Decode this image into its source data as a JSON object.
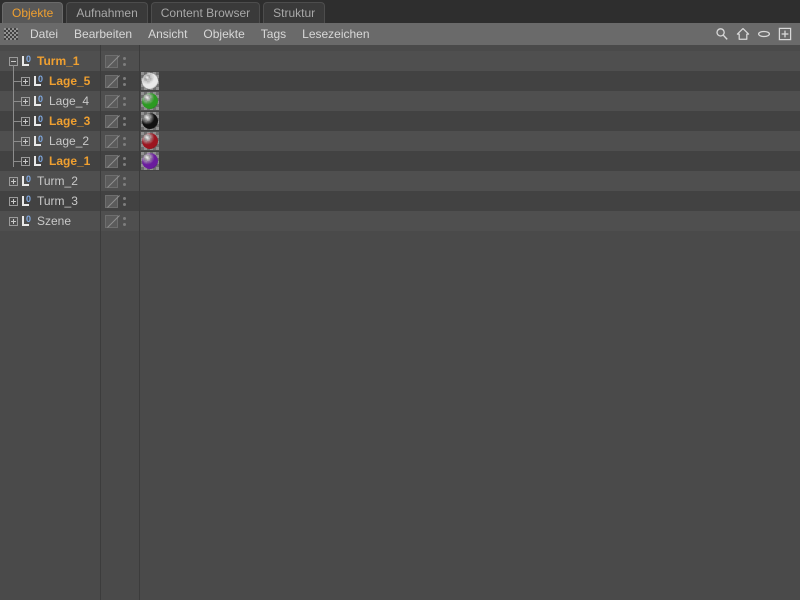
{
  "tabs": [
    {
      "label": "Objekte",
      "active": true
    },
    {
      "label": "Aufnahmen",
      "active": false
    },
    {
      "label": "Content Browser",
      "active": false
    },
    {
      "label": "Struktur",
      "active": false
    }
  ],
  "menu": {
    "items": [
      {
        "label": "Datei"
      },
      {
        "label": "Bearbeiten"
      },
      {
        "label": "Ansicht"
      },
      {
        "label": "Objekte"
      },
      {
        "label": "Tags"
      },
      {
        "label": "Lesezeichen"
      }
    ],
    "icons": [
      {
        "name": "search-icon"
      },
      {
        "name": "home-icon"
      },
      {
        "name": "ellipse-icon"
      },
      {
        "name": "add-box-icon"
      }
    ]
  },
  "colors": {
    "selected_text": "#f0a030",
    "normal_text": "#c9c9c9",
    "row_light": "#4f4f4f",
    "row_dark": "#424242",
    "panel_bg": "#4a4a4a",
    "menubar_bg": "#6a6a6a",
    "tabbar_bg": "#2e2e2e",
    "null_icon_accent": "#7fa8e0"
  },
  "tree": {
    "objects": [
      {
        "name": "Turm_1",
        "depth": 0,
        "selected": true,
        "expanded": true,
        "icon": "null-object-icon",
        "tag_icon": "disabled-layer-icon",
        "material": null
      },
      {
        "name": "Lage_5",
        "depth": 1,
        "selected": true,
        "expanded": false,
        "icon": "null-object-icon",
        "tag_icon": "disabled-layer-icon",
        "material": "#e9e9e9"
      },
      {
        "name": "Lage_4",
        "depth": 1,
        "selected": false,
        "expanded": false,
        "icon": "null-object-icon",
        "tag_icon": "disabled-layer-icon",
        "material": "#2c9a22"
      },
      {
        "name": "Lage_3",
        "depth": 1,
        "selected": true,
        "expanded": false,
        "icon": "null-object-icon",
        "tag_icon": "disabled-layer-icon",
        "material": "#111111"
      },
      {
        "name": "Lage_2",
        "depth": 1,
        "selected": false,
        "expanded": false,
        "icon": "null-object-icon",
        "tag_icon": "disabled-layer-icon",
        "material": "#9c1520"
      },
      {
        "name": "Lage_1",
        "depth": 1,
        "selected": true,
        "expanded": false,
        "icon": "null-object-icon",
        "tag_icon": "disabled-layer-icon",
        "material": "#6a1b9e"
      },
      {
        "name": "Turm_2",
        "depth": 0,
        "selected": false,
        "expanded": false,
        "icon": "null-object-icon",
        "tag_icon": "disabled-layer-icon",
        "material": null
      },
      {
        "name": "Turm_3",
        "depth": 0,
        "selected": false,
        "expanded": false,
        "icon": "null-object-icon",
        "tag_icon": "disabled-layer-icon",
        "material": null
      },
      {
        "name": "Szene",
        "depth": 0,
        "selected": false,
        "expanded": false,
        "icon": "null-object-icon",
        "tag_icon": "disabled-layer-icon",
        "material": null
      }
    ]
  }
}
